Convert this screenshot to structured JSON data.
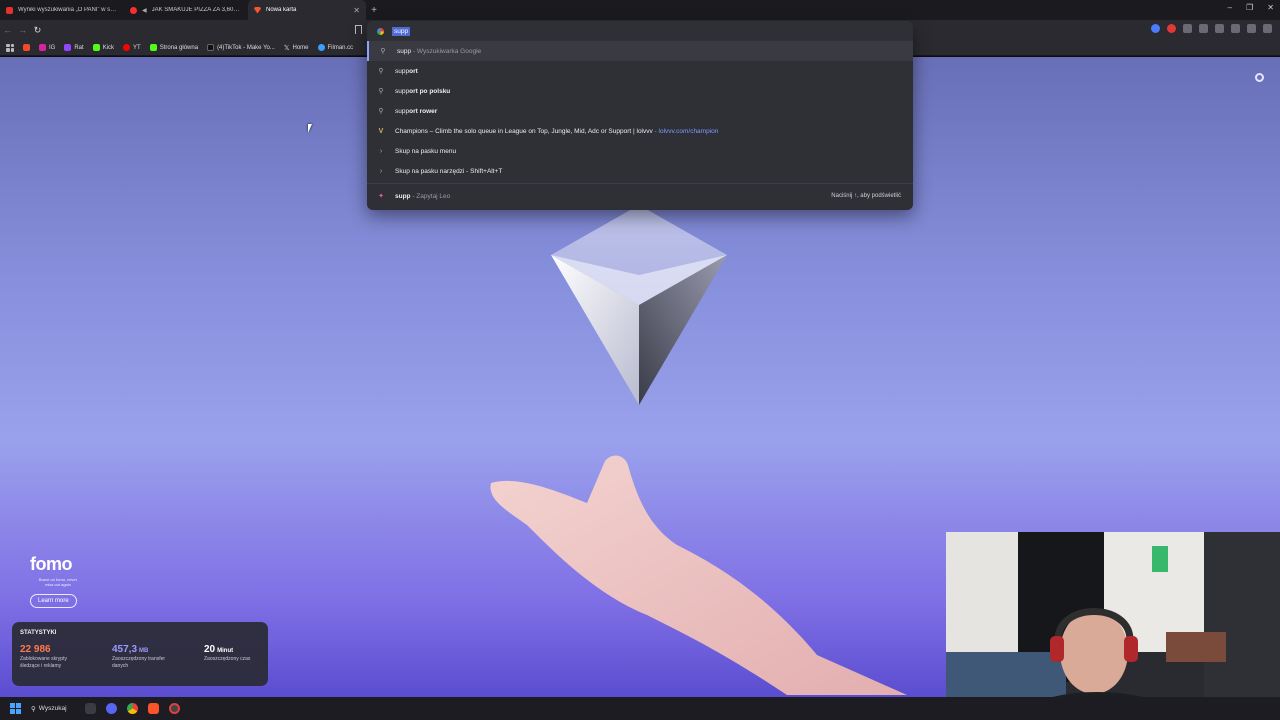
{
  "tabs": [
    {
      "title": "Wyniki wyszukiwania „O PANI” w serwisie",
      "favicon": "red-square-icon"
    },
    {
      "title": "JAK SMAKUJE PIZZA ZA 3,60zł? -",
      "favicon": "youtube-icon"
    },
    {
      "title": "Nowa karta",
      "favicon": "brave-icon",
      "active": true
    }
  ],
  "bookmarks": [
    {
      "label": "",
      "icon": "mail-icon",
      "color": "#f04b2d"
    },
    {
      "label": "IG",
      "icon": "instagram-icon",
      "color": "#d6249f"
    },
    {
      "label": "Rat",
      "icon": "twitch-icon",
      "color": "#9146ff"
    },
    {
      "label": "Kick",
      "icon": "kick-icon",
      "color": "#53fc18"
    },
    {
      "label": "YT",
      "icon": "youtube-icon",
      "color": "#ff0000"
    },
    {
      "label": "Strona główna",
      "icon": "kick-icon",
      "color": "#53fc18"
    },
    {
      "label": "(4)TikTok - Make Yo...",
      "icon": "tiktok-icon",
      "color": "#111111"
    },
    {
      "label": "Home",
      "icon": "x-icon",
      "color": "#111111"
    },
    {
      "label": "Filman.cc",
      "icon": "filman-icon",
      "color": "#3aa0ff"
    }
  ],
  "omnibox": {
    "query": "supp",
    "suggestions": [
      {
        "icon": "search-icon",
        "match": "supp",
        "rest": "",
        "note": " - Wyszukiwarka Google",
        "selected": true
      },
      {
        "icon": "search-icon",
        "match": "supp",
        "rest": "ort",
        "note": ""
      },
      {
        "icon": "search-icon",
        "match": "supp",
        "rest": "ort po polsku",
        "note": ""
      },
      {
        "icon": "search-icon",
        "match": "supp",
        "rest": "ort rower",
        "note": ""
      },
      {
        "icon": "lolvvv-icon",
        "text": "Champions – Climb the solo queue in League on Top, Jungle, Mid, Adc or Support | lolvvv",
        "link": " - lolvvv.com/champion"
      },
      {
        "icon": "chevron-right-icon",
        "text": "Skup na pasku menu"
      },
      {
        "icon": "chevron-right-icon",
        "text": "Skup na pasku narzędzi - Shift+Alt+T"
      }
    ],
    "leo": {
      "query": "supp",
      "note": " - Zapytaj Leo",
      "hint": "Naciśnij ↑, aby podświetlić"
    }
  },
  "fomo": {
    "title": "fomo",
    "subtitle": "Brave on fomo, never miss out again",
    "button": "Learn more"
  },
  "stats": {
    "heading": "STATYSTYKI",
    "items": [
      {
        "value": "22 986",
        "unit": "",
        "desc": "Zablokowane skrypty śledzące i reklamy",
        "color": "#ff7a4f"
      },
      {
        "value": "457,3",
        "unit": "MB",
        "desc": "Zaoszczędzony transfer danych",
        "color": "#9a9cff"
      },
      {
        "value": "20",
        "unit": "Minut",
        "desc": "Zaoszczędzony czas",
        "color": "#ffffff"
      }
    ]
  },
  "taskbar": {
    "search": "Wyszukaj"
  }
}
